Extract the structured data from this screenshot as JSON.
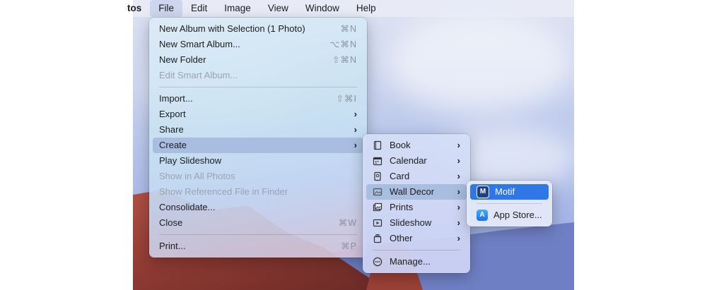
{
  "menubar": {
    "app": "tos",
    "items": [
      "File",
      "Edit",
      "Image",
      "View",
      "Window",
      "Help"
    ]
  },
  "file_menu": {
    "items": [
      {
        "label": "New Album with Selection (1 Photo)",
        "shortcut": "⌘N"
      },
      {
        "label": "New Smart Album...",
        "shortcut": "⌥⌘N"
      },
      {
        "label": "New Folder",
        "shortcut": "⇧⌘N"
      },
      {
        "label": "Edit Smart Album..."
      },
      {
        "label": "Import...",
        "shortcut": "⇧⌘I"
      },
      {
        "label": "Export"
      },
      {
        "label": "Share"
      },
      {
        "label": "Create"
      },
      {
        "label": "Play Slideshow"
      },
      {
        "label": "Show in All Photos"
      },
      {
        "label": "Show Referenced File in Finder"
      },
      {
        "label": "Consolidate..."
      },
      {
        "label": "Close",
        "shortcut": "⌘W"
      },
      {
        "label": "Print...",
        "shortcut": "⌘P"
      }
    ]
  },
  "create_menu": {
    "items": [
      {
        "label": "Book",
        "icon": "book-icon"
      },
      {
        "label": "Calendar",
        "icon": "calendar-icon"
      },
      {
        "label": "Card",
        "icon": "card-icon"
      },
      {
        "label": "Wall Decor",
        "icon": "picture-icon"
      },
      {
        "label": "Prints",
        "icon": "prints-icon"
      },
      {
        "label": "Slideshow",
        "icon": "slideshow-icon"
      },
      {
        "label": "Other",
        "icon": "stack-icon"
      },
      {
        "label": "Manage...",
        "icon": "ellipsis-circle-icon"
      }
    ]
  },
  "wall_decor_menu": {
    "items": [
      {
        "label": "Motif",
        "icon": "motif-app-icon"
      },
      {
        "label": "App Store...",
        "icon": "app-store-icon"
      }
    ]
  },
  "colors": {
    "selection": "#2f77e6",
    "highlight": "#a9bde0"
  }
}
